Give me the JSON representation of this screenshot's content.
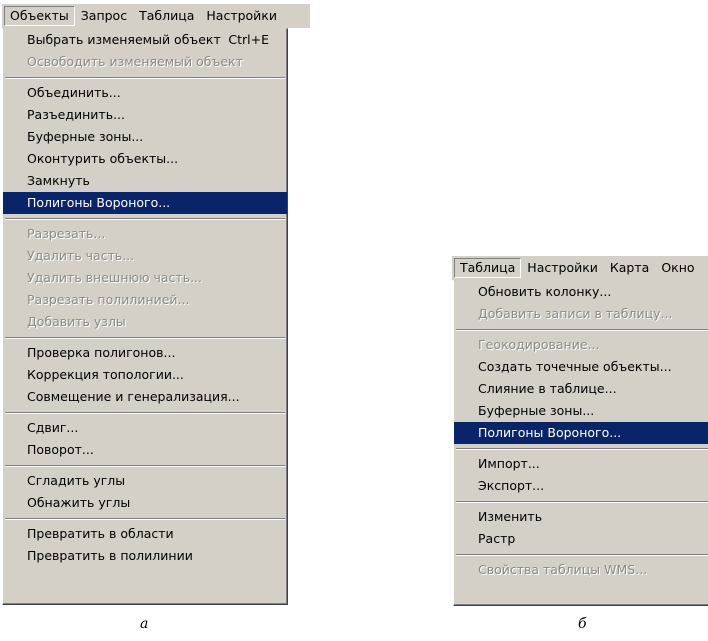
{
  "left": {
    "menubar": [
      "Объекты",
      "Запрос",
      "Таблица",
      "Настройки"
    ],
    "shortcut": "Ctrl+E",
    "items": [
      {
        "label": "Выбрать изменяемый объект",
        "state": "normal"
      },
      {
        "label": "Освободить изменяемый объект",
        "state": "disabled"
      },
      {
        "label": "Объединить...",
        "state": "normal"
      },
      {
        "label": "Разъединить...",
        "state": "normal"
      },
      {
        "label": "Буферные зоны...",
        "state": "normal"
      },
      {
        "label": "Оконтурить объекты...",
        "state": "normal"
      },
      {
        "label": "Замкнуть",
        "state": "normal"
      },
      {
        "label": "Полигоны Вороного...",
        "state": "highlighted"
      },
      {
        "label": "Разрезать...",
        "state": "disabled"
      },
      {
        "label": "Удалить часть...",
        "state": "disabled"
      },
      {
        "label": "Удалить внешнюю часть...",
        "state": "disabled"
      },
      {
        "label": "Разрезать полилинией...",
        "state": "disabled"
      },
      {
        "label": "Добавить узлы",
        "state": "disabled"
      },
      {
        "label": "Проверка полигонов...",
        "state": "normal"
      },
      {
        "label": "Коррекция топологии...",
        "state": "normal"
      },
      {
        "label": "Совмещение и генерализация...",
        "state": "normal"
      },
      {
        "label": "Сдвиг...",
        "state": "normal"
      },
      {
        "label": "Поворот...",
        "state": "normal"
      },
      {
        "label": "Сгладить углы",
        "state": "normal"
      },
      {
        "label": "Обнажить углы",
        "state": "normal"
      },
      {
        "label": "Превратить в области",
        "state": "normal"
      },
      {
        "label": "Превратить в полилинии",
        "state": "normal"
      }
    ],
    "caption": "а"
  },
  "right": {
    "menubar": [
      "Таблица",
      "Настройки",
      "Карта",
      "Окно"
    ],
    "items": [
      {
        "label": "Обновить колонку...",
        "state": "normal"
      },
      {
        "label": "Добавить записи в таблицу...",
        "state": "disabled"
      },
      {
        "label": "Геокодирование...",
        "state": "disabled"
      },
      {
        "label": "Создать точечные объекты...",
        "state": "normal"
      },
      {
        "label": "Слияние в таблице...",
        "state": "normal"
      },
      {
        "label": "Буферные зоны...",
        "state": "normal"
      },
      {
        "label": "Полигоны Вороного...",
        "state": "highlighted"
      },
      {
        "label": "Импорт...",
        "state": "normal"
      },
      {
        "label": "Экспорт...",
        "state": "normal"
      },
      {
        "label": "Изменить",
        "state": "normal",
        "submenu": true
      },
      {
        "label": "Растр",
        "state": "normal",
        "submenu": true
      },
      {
        "label": "Свойства таблицы WMS...",
        "state": "disabled"
      }
    ],
    "caption": "б"
  },
  "colors": {
    "menu_bg": "#d4d0c8",
    "highlight": "#0a246a",
    "disabled": "#8c8a85"
  }
}
